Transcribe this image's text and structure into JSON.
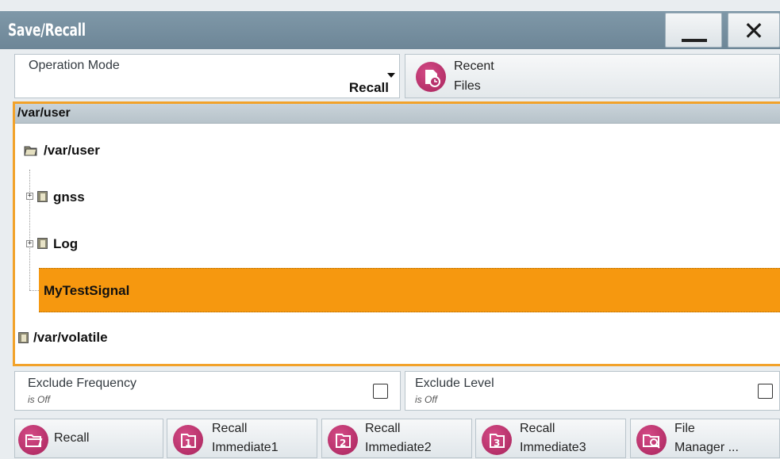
{
  "window": {
    "title": "Save/Recall",
    "minimize_symbol": "",
    "close_symbol": "✕"
  },
  "operation_mode": {
    "label": "Operation Mode",
    "value": "Recall"
  },
  "recent_files": {
    "line1": "Recent",
    "line2": "Files"
  },
  "file_tree": {
    "current_path": "/var/user",
    "nodes": [
      {
        "label": "/var/user"
      },
      {
        "label": "gnss"
      },
      {
        "label": "Log"
      },
      {
        "label": "MyTestSignal",
        "selected": true
      },
      {
        "label": "/var/volatile"
      }
    ]
  },
  "exclude_frequency": {
    "label": "Exclude Frequency",
    "state": "is Off",
    "checked": false
  },
  "exclude_level": {
    "label": "Exclude Level",
    "state": "is Off",
    "checked": false
  },
  "bottom_buttons": [
    {
      "line1": "Recall",
      "line2": ""
    },
    {
      "line1": "Recall",
      "line2": "Immediate1",
      "badge": "1"
    },
    {
      "line1": "Recall",
      "line2": "Immediate2",
      "badge": "2"
    },
    {
      "line1": "Recall",
      "line2": "Immediate3",
      "badge": "3"
    },
    {
      "line1": "File",
      "line2": "Manager ..."
    }
  ],
  "colors": {
    "accent_orange": "#f6980f",
    "title_bar": "#7790a1",
    "icon_magenta": "#b8306d"
  }
}
